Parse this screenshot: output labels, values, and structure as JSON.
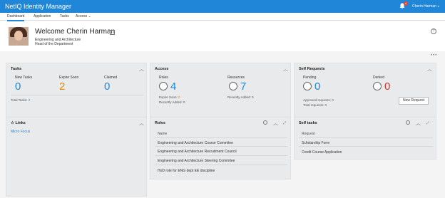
{
  "app": {
    "title": "NetIQ Identity Manager",
    "notification_count": "4",
    "user_name": "Cherin Harman"
  },
  "nav": {
    "tabs": [
      "Dashboard",
      "Application",
      "Tasks",
      "Access"
    ]
  },
  "welcome": {
    "title": "Welcome Cherin Harman",
    "department": "Engineering and Architecture",
    "role": "Head of the Department"
  },
  "tasks": {
    "title": "Tasks",
    "cols": [
      {
        "label": "New Tasks",
        "value": "0"
      },
      {
        "label": "Expire Soon",
        "value": "2"
      },
      {
        "label": "Claimed",
        "value": "0"
      }
    ],
    "total_label": "Total Tasks:",
    "total_value": "2"
  },
  "access": {
    "title": "Access",
    "roles_label": "Roles",
    "roles_value": "4",
    "resources_label": "Resources",
    "resources_value": "7",
    "expire_soon_label": "Expire Soon:",
    "expire_soon_value": "0",
    "recent_roles_label": "Recently Added:",
    "recent_roles_value": "0",
    "recent_res_label": "Recently Added:",
    "recent_res_value": "0"
  },
  "self_requests": {
    "title": "Self Requests",
    "pending_label": "Pending",
    "pending_value": "0",
    "denied_label": "Denied",
    "denied_value": "0",
    "approved_label": "Approved requests:",
    "approved_value": "0",
    "total_label": "Total requests:",
    "total_value": "0",
    "new_request": "New Request"
  },
  "links": {
    "title": "Links",
    "items": [
      "Micro Focus"
    ]
  },
  "roles": {
    "title": "Roles",
    "column": "Name",
    "items": [
      "Engineering and Architecture Course Commitee",
      "Engineering and Architecture Recruitment Council",
      "Engineering and Architecture Steering Commitee",
      "HoD role for ENG dept EE discipline"
    ]
  },
  "self_tasks": {
    "title": "Self tasks",
    "column": "Request",
    "items": [
      "Scholarship Form",
      "Credit Course Application"
    ]
  },
  "colors": {
    "brand": "#1f86d8",
    "orange": "#e08a00",
    "red": "#d9302b"
  }
}
